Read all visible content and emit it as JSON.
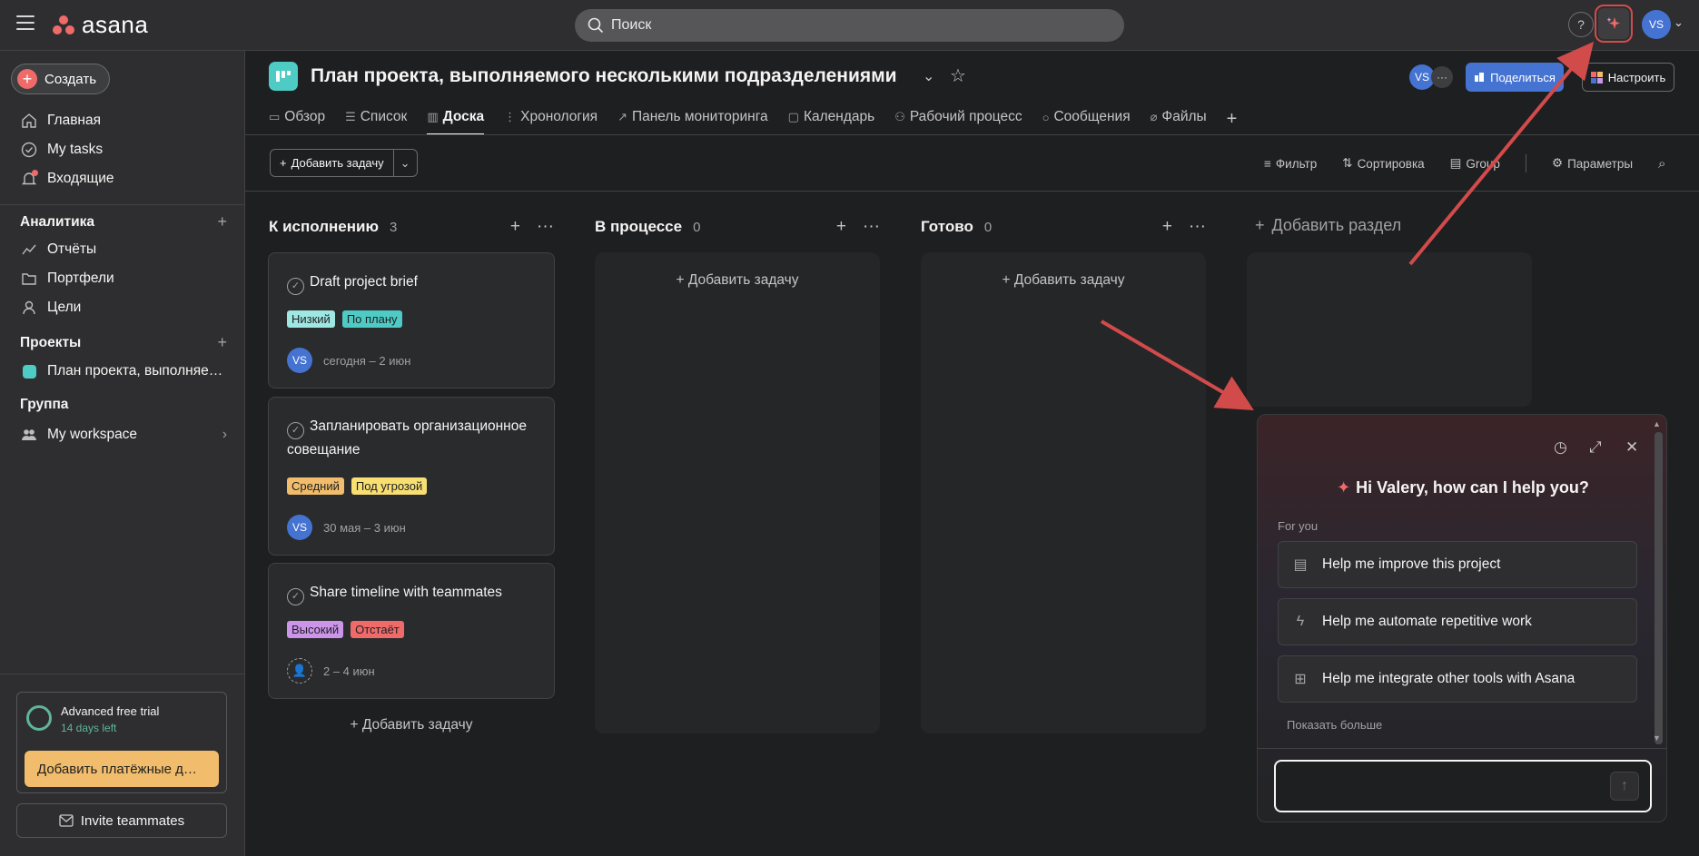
{
  "topbar": {
    "logo_text": "asana",
    "search_placeholder": "Поиск",
    "help_label": "?",
    "user_initials": "VS"
  },
  "sidebar": {
    "create_label": "Создать",
    "nav": [
      {
        "label": "Главная",
        "icon": "home-icon"
      },
      {
        "label": "My tasks",
        "icon": "check-circle-icon"
      },
      {
        "label": "Входящие",
        "icon": "bell-icon"
      }
    ],
    "analytics": {
      "title": "Аналитика",
      "items": [
        {
          "label": "Отчёты",
          "icon": "reports-icon"
        },
        {
          "label": "Портфели",
          "icon": "folder-icon"
        },
        {
          "label": "Цели",
          "icon": "goals-icon"
        }
      ]
    },
    "projects": {
      "title": "Проекты",
      "items": [
        {
          "label": "План проекта, выполняе…",
          "color": "#4ecbc4"
        }
      ]
    },
    "group": {
      "title": "Группа",
      "items": [
        {
          "label": "My workspace",
          "icon": "team-icon"
        }
      ]
    },
    "trial": {
      "title": "Advanced free trial",
      "subtitle": "14 days left",
      "pay_label": "Добавить платёжные д…"
    },
    "invite_label": "Invite teammates"
  },
  "project": {
    "title": "План проекта, выполняемого несколькими подразделениями",
    "member_initials": "VS",
    "share_label": "Поделиться",
    "customize_label": "Настроить",
    "tabs": [
      {
        "label": "Обзор",
        "icon": "overview-icon"
      },
      {
        "label": "Список",
        "icon": "list-icon"
      },
      {
        "label": "Доска",
        "icon": "board-icon",
        "active": true
      },
      {
        "label": "Хронология",
        "icon": "timeline-icon"
      },
      {
        "label": "Панель мониторинга",
        "icon": "dashboard-icon"
      },
      {
        "label": "Календарь",
        "icon": "calendar-icon"
      },
      {
        "label": "Рабочий процесс",
        "icon": "workflow-icon"
      },
      {
        "label": "Сообщения",
        "icon": "messages-icon"
      },
      {
        "label": "Файлы",
        "icon": "files-icon"
      }
    ]
  },
  "toolbar": {
    "add_task_label": "Добавить задачу",
    "filter_label": "Фильтр",
    "sort_label": "Сортировка",
    "group_label": "Group",
    "options_label": "Параметры"
  },
  "board": {
    "columns": [
      {
        "title": "К исполнению",
        "count": "3"
      },
      {
        "title": "В процессе",
        "count": "0",
        "add_label": "Добавить задачу"
      },
      {
        "title": "Готово",
        "count": "0",
        "add_label": "Добавить задачу"
      }
    ],
    "add_section_label": "Добавить раздел",
    "bottom_add_label": "Добавить задачу",
    "cards": [
      {
        "title": "Draft project brief",
        "tags": [
          {
            "label": "Низкий",
            "color": "#9ee7e3"
          },
          {
            "label": "По плану",
            "color": "#4ecbc4"
          }
        ],
        "assignee": "VS",
        "dates": "сегодня – 2 июн"
      },
      {
        "title": "Запланировать организационное совещание",
        "tags": [
          {
            "label": "Средний",
            "color": "#f1bd6c"
          },
          {
            "label": "Под угрозой",
            "color": "#f8df72"
          }
        ],
        "assignee": "VS",
        "dates": "30 мая – 3 июн"
      },
      {
        "title": "Share timeline with teammates",
        "tags": [
          {
            "label": "Высокий",
            "color": "#cd95ea"
          },
          {
            "label": "Отстаёт",
            "color": "#f06a6a"
          }
        ],
        "assignee": "",
        "dates": "2 – 4 июн"
      }
    ]
  },
  "ai_panel": {
    "greeting": "Hi Valery, how can I help you?",
    "for_you_label": "For you",
    "suggestions": [
      {
        "label": "Help me improve this project",
        "icon": "clipboard-icon"
      },
      {
        "label": "Help me automate repetitive work",
        "icon": "lightning-icon"
      },
      {
        "label": "Help me integrate other tools with Asana",
        "icon": "apps-icon"
      }
    ],
    "show_more_label": "Показать больше"
  },
  "colors": {
    "accent_blue": "#4573d2",
    "brand_coral": "#f06a6a",
    "annotation_red": "#d24b4b",
    "trial_yellow": "#f1bd6c"
  }
}
